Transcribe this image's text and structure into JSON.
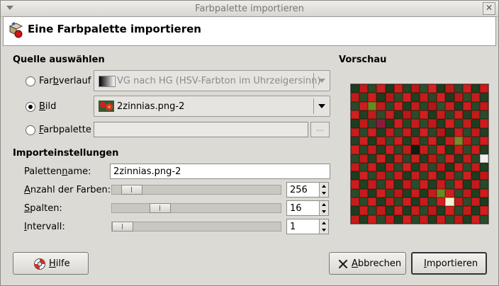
{
  "window": {
    "title": "Farbpalette importieren"
  },
  "header": {
    "title": "Eine Farbpalette importieren"
  },
  "source": {
    "heading": "Quelle auswählen",
    "gradient": {
      "label_pre": "Far",
      "label_u": "b",
      "label_post": "verlauf",
      "value": "VG nach HG (HSV-Farbton im Uhrzeigersinn)",
      "selected": false
    },
    "image": {
      "label_pre": "",
      "label_u": "B",
      "label_post": "ild",
      "value": "2zinnias.png-2",
      "selected": true
    },
    "palette": {
      "label_pre": "",
      "label_u": "F",
      "label_post": "arbpalette",
      "value": "",
      "browse_label": "...",
      "selected": false
    }
  },
  "settings": {
    "heading": "Importeinstellungen",
    "palette_name": {
      "label_pre": "Paletten",
      "label_u": "n",
      "label_post": "ame:",
      "value": "2zinnias.png-2"
    },
    "num_colors": {
      "label_pre": "",
      "label_u": "A",
      "label_post": "nzahl der Farben:",
      "value": "256",
      "slider_fraction": 0.06
    },
    "columns": {
      "label_pre": "",
      "label_u": "S",
      "label_post": "palten:",
      "value": "16",
      "slider_fraction": 0.25
    },
    "interval": {
      "label_pre": "",
      "label_u": "I",
      "label_post": "ntervall:",
      "value": "1",
      "slider_fraction": 0.0
    }
  },
  "preview": {
    "heading": "Vorschau"
  },
  "buttons": {
    "help": {
      "label_pre": "",
      "label_u": "H",
      "label_post": "ilfe"
    },
    "cancel": {
      "label_pre": "",
      "label_u": "A",
      "label_post": "bbrechen"
    },
    "import": {
      "label_pre": "",
      "label_u": "I",
      "label_post": "mportieren"
    }
  },
  "palette_colors": [
    "#1f3d1f",
    "#c41a1a",
    "#2a4a28",
    "#c82020",
    "#1c3a1c",
    "#d01c1c",
    "#254526",
    "#b81818",
    "#2f4f2c",
    "#d42222",
    "#1e3a1e",
    "#c01919",
    "#294928",
    "#d21e1e",
    "#213f21",
    "#cc1b1b",
    "#c21a1a",
    "#284826",
    "#d11d1d",
    "#1d3b1d",
    "#b91717",
    "#2c4b2a",
    "#cf1f1f",
    "#213f21",
    "#c41b1b",
    "#2a4828",
    "#d31f1f",
    "#1f3b1f",
    "#bd1818",
    "#2d4d2b",
    "#c71c1c",
    "#243f24",
    "#2a4a28",
    "#cd1e1e",
    "#6a8a20",
    "#c31b1b",
    "#2b492a",
    "#d51f1f",
    "#1f3c1f",
    "#c61b1b",
    "#284726",
    "#b51616",
    "#30502e",
    "#cc1e1e",
    "#213d21",
    "#d01d1d",
    "#294828",
    "#c01a1a",
    "#d31f1f",
    "#213f21",
    "#c51a1a",
    "#2d4c2b",
    "#c91d1d",
    "#1f3c1f",
    "#bb1717",
    "#2b4b29",
    "#d21e1e",
    "#1e3b1e",
    "#c81c1c",
    "#2a4828",
    "#cf1f1f",
    "#223f22",
    "#c31a1a",
    "#2c4a2a",
    "#1e3c1e",
    "#c21a1a",
    "#2a4828",
    "#8e1a3a",
    "#1f3d1f",
    "#d01e1e",
    "#274526",
    "#c61b1b",
    "#2d4b2b",
    "#be1818",
    "#213e21",
    "#d31f1f",
    "#284727",
    "#c91d1d",
    "#1f3c1f",
    "#cc1c1c",
    "#c71c1c",
    "#2b4a29",
    "#d11e1e",
    "#203e20",
    "#c41a1a",
    "#2b4a29",
    "#ca1c1c",
    "#223f22",
    "#d21f1f",
    "#2a4828",
    "#b91717",
    "#1e3b1e",
    "#cd1d1d",
    "#2c4b2a",
    "#c21a1a",
    "#253f25",
    "#273f24",
    "#cf1f1f",
    "#1f3c1f",
    "#c51b1b",
    "#2d4c2b",
    "#ce1e1e",
    "#213f21",
    "#bf1818",
    "#284726",
    "#d31f1f",
    "#1f3c1f",
    "#c71c1c",
    "#788a2a",
    "#c21a1a",
    "#2b4a29",
    "#d01e1e",
    "#d01e1e",
    "#284727",
    "#c61b1b",
    "#203e20",
    "#cb1d1d",
    "#2a4928",
    "#c31a1a",
    "#0f1f0f",
    "#c81c1c",
    "#2b4a29",
    "#d21f1f",
    "#1f3c1f",
    "#c51b1b",
    "#2d4c2b",
    "#ca1c1c",
    "#213e21",
    "#2b4a29",
    "#c41a1a",
    "#224022",
    "#d31f1f",
    "#1f3d1f",
    "#c91d1d",
    "#2a4928",
    "#ce1e1e",
    "#213f21",
    "#c01818",
    "#2c4b2a",
    "#d11e1e",
    "#203e20",
    "#c71c1c",
    "#294828",
    "#f0f0f0",
    "#c61b1b",
    "#2b4a29",
    "#cd1d1d",
    "#1f3c1f",
    "#c21a1a",
    "#2b4a29",
    "#d31f1f",
    "#213f21",
    "#c81c1c",
    "#2a4928",
    "#be1818",
    "#1e3b1e",
    "#d01e1e",
    "#2c4b2a",
    "#c51b1b",
    "#223f22",
    "#1f3c1f",
    "#d21f1f",
    "#2a4828",
    "#c41a1a",
    "#2c4b2a",
    "#ca1c1c",
    "#1f3d1f",
    "#c71c1c",
    "#284726",
    "#d11e1e",
    "#213e21",
    "#c31a1a",
    "#2b4a29",
    "#cf1f1f",
    "#1e3b1e",
    "#c01818",
    "#cc1d1d",
    "#213f21",
    "#c61b1b",
    "#2a4828",
    "#d01e1e",
    "#1f3c1f",
    "#c41a1a",
    "#2d4c2b",
    "#ce1e1e",
    "#203e20",
    "#c81c1c",
    "#2b4a29",
    "#d31f1f",
    "#1f3c1f",
    "#c21a1a",
    "#294828",
    "#2b4a29",
    "#c51b1b",
    "#1f3c1f",
    "#d21f1f",
    "#2a4928",
    "#c01818",
    "#213f21",
    "#cb1d1d",
    "#1e3b1e",
    "#c61b1b",
    "#6a8a20",
    "#d01e1e",
    "#2c4b2a",
    "#c41a1a",
    "#213e21",
    "#cd1d1d",
    "#c81c1c",
    "#2c4b2a",
    "#d11e1e",
    "#203e20",
    "#c31a1a",
    "#2b4a29",
    "#cf1f1f",
    "#1f3c1f",
    "#c61b1b",
    "#2a4828",
    "#d31f1f",
    "#eff5d0",
    "#c21a1a",
    "#2d4c2b",
    "#ca1c1c",
    "#1e3b1e",
    "#1f3c1f",
    "#cc1d1d",
    "#2a4928",
    "#c41a1a",
    "#213f21",
    "#d01e1e",
    "#1f3d1f",
    "#c71c1c",
    "#2b4a29",
    "#be1818",
    "#213e21",
    "#d21f1f",
    "#2c4b2a",
    "#c51b1b",
    "#1f3c1f",
    "#cf1f1f",
    "#c61b1b",
    "#223f22",
    "#ce1e1e",
    "#2b4a29",
    "#c21a1a",
    "#1f3c1f",
    "#d31f1f",
    "#2a4828",
    "#c81c1c",
    "#203e20",
    "#cb1d1d",
    "#2c4b2a",
    "#c01818",
    "#213f21",
    "#d11e1e",
    "#2b4a29"
  ]
}
